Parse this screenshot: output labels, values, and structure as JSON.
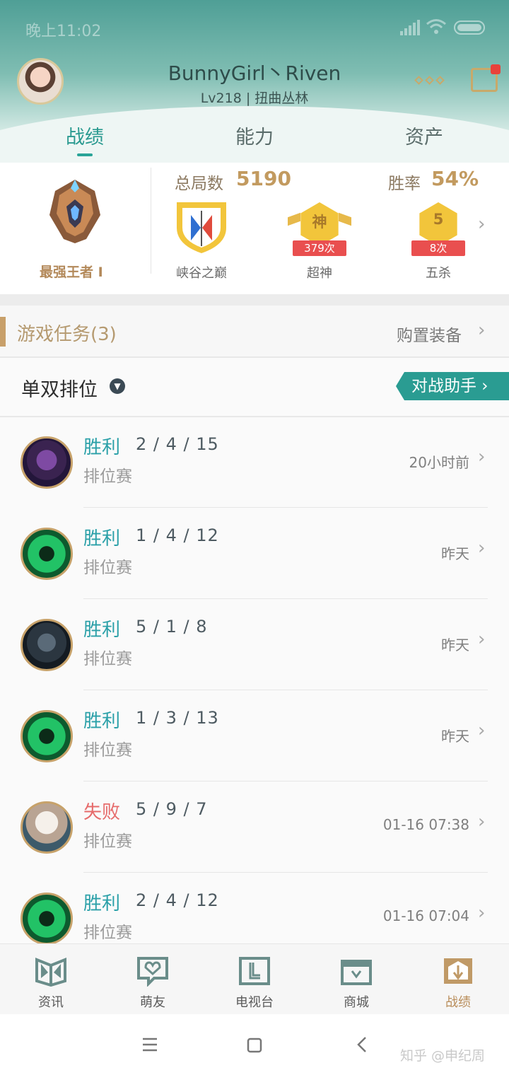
{
  "status_bar": {
    "time": "晚上11:02"
  },
  "profile": {
    "name": "BunnyGirl丶Riven",
    "level": "Lv218 | 扭曲丛林"
  },
  "tabs": [
    "战绩",
    "能力",
    "资产"
  ],
  "stats": {
    "rank": "最强王者 I",
    "total_label": "总局数",
    "total_value": "5190",
    "winrate_label": "胜率",
    "winrate_value": "54%",
    "badges": [
      {
        "label": "峡谷之巅",
        "icon": "peak-badge-icon"
      },
      {
        "label": "超神",
        "count": "379次",
        "glyph": "神",
        "icon": "legendary-badge-icon"
      },
      {
        "label": "五杀",
        "count": "8次",
        "glyph": "5",
        "icon": "pentakill-badge-icon"
      }
    ]
  },
  "mission": {
    "title": "游戏任务(3)",
    "right_link": "购置装备"
  },
  "mode": {
    "selected": "单双排位",
    "assistant_button": "对战助手"
  },
  "matches": [
    {
      "result": "胜利",
      "kda": "2 / 4 / 15",
      "type": "排位赛",
      "time": "20小时前",
      "win": true,
      "champ": "purple"
    },
    {
      "result": "胜利",
      "kda": "1 / 4 / 12",
      "type": "排位赛",
      "time": "昨天",
      "win": true,
      "champ": "green"
    },
    {
      "result": "胜利",
      "kda": "5 / 1 / 8",
      "type": "排位赛",
      "time": "昨天",
      "win": true,
      "champ": "dark"
    },
    {
      "result": "胜利",
      "kda": "1 / 3 / 13",
      "type": "排位赛",
      "time": "昨天",
      "win": true,
      "champ": "green"
    },
    {
      "result": "失败",
      "kda": "5 / 9 / 7",
      "type": "排位赛",
      "time": "01-16 07:38",
      "win": false,
      "champ": "light"
    },
    {
      "result": "胜利",
      "kda": "2 / 4 / 12",
      "type": "排位赛",
      "time": "01-16 07:04",
      "win": true,
      "champ": "green"
    }
  ],
  "bottom_nav": [
    {
      "label": "资讯",
      "icon": "news-icon"
    },
    {
      "label": "萌友",
      "icon": "friends-icon"
    },
    {
      "label": "电视台",
      "icon": "tv-icon"
    },
    {
      "label": "商城",
      "icon": "store-icon"
    },
    {
      "label": "战绩",
      "icon": "record-icon",
      "active": true
    }
  ],
  "watermark": "知乎 @申纪周",
  "colors": {
    "accent": "#2a9c92",
    "win": "#2aa0a8",
    "loss": "#e66b6b",
    "gold": "#c29a5f"
  }
}
